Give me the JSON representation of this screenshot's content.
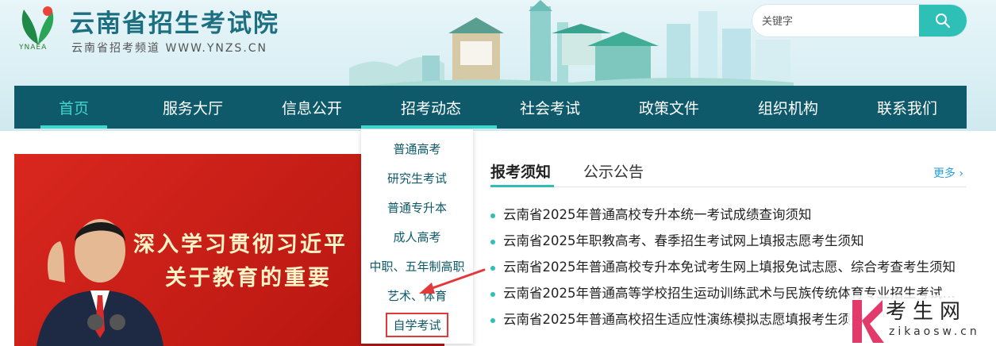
{
  "header": {
    "site_title": "云南省招生考试院",
    "site_subtitle": "云南省招考频道 WWW.YNZS.CN",
    "logo_text": "YNAEA",
    "search": {
      "placeholder": "关键字"
    }
  },
  "nav": {
    "items": [
      {
        "label": "首页"
      },
      {
        "label": "服务大厅"
      },
      {
        "label": "信息公开"
      },
      {
        "label": "招考动态"
      },
      {
        "label": "社会考试"
      },
      {
        "label": "政策文件"
      },
      {
        "label": "组织机构"
      },
      {
        "label": "联系我们"
      }
    ],
    "active_index": 0,
    "open_index": 3
  },
  "dropdown": {
    "items": [
      {
        "label": "普通高考"
      },
      {
        "label": "研究生考试"
      },
      {
        "label": "普通专升本"
      },
      {
        "label": "成人高考"
      },
      {
        "label": "中职、五年制高职"
      },
      {
        "label": "艺术、体育"
      },
      {
        "label": "自学考试"
      }
    ],
    "highlighted_index": 6
  },
  "banner": {
    "line1": "深入学习贯彻习近平",
    "line2": "关于教育的重要"
  },
  "news": {
    "tabs": [
      {
        "label": "报考须知"
      },
      {
        "label": "公示公告"
      }
    ],
    "active_tab": 0,
    "more_label": "更多",
    "items": [
      {
        "title": "云南省2025年普通高校专升本统一考试成绩查询须知"
      },
      {
        "title": "云南省2025年职教高考、春季招生考试网上填报志愿考生须知"
      },
      {
        "title": "云南省2025年普通高校专升本免试考生网上填报免试志愿、综合考查考生须知"
      },
      {
        "title": "云南省2025年普通高等学校招生运动训练武术与民族传统体育专业招生考试须知"
      },
      {
        "title": "云南省2025年普通高校招生适应性演练模拟志愿填报考生须知"
      }
    ]
  },
  "watermark": {
    "title": "考生网",
    "url": "zikaosw.cn"
  },
  "colors": {
    "nav_bg": "#0e5a6a",
    "accent": "#2ebfb7",
    "active_nav": "#3fd6cf",
    "banner_red": "#c41d16",
    "highlight_box": "#e23a3a"
  },
  "icons": {
    "search": "search-icon",
    "more": "chevron-right-icon",
    "logo": "logo-leaf-icon"
  }
}
